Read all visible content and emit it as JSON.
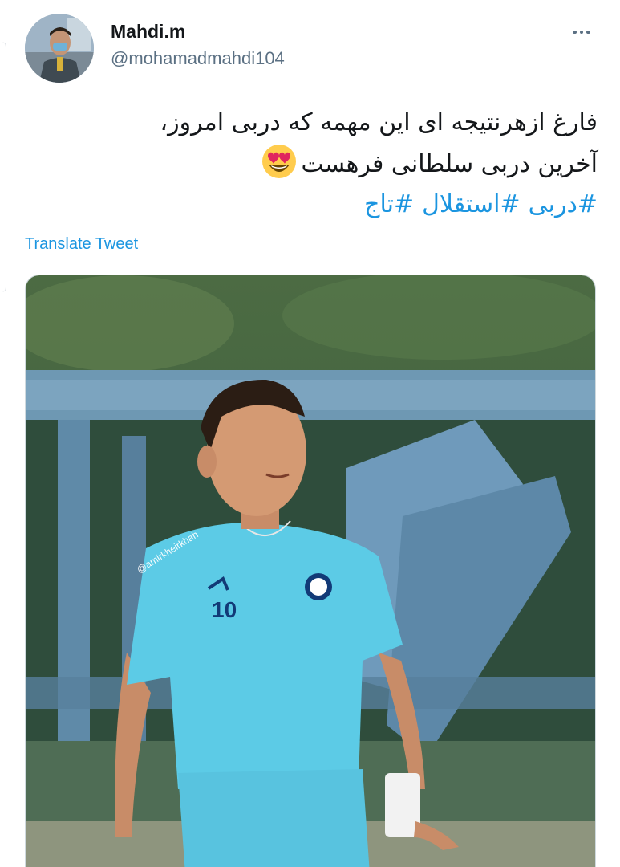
{
  "tweet": {
    "author": {
      "display_name": "Mahdi.m",
      "handle": "@mohamadmahdi104"
    },
    "text": {
      "line1": "فارغ ازهرنتیجه ای این مهمه که دربی امروز،",
      "line2": "آخرین دربی سلطانی فرهست",
      "emoji": "smiling-face-with-heart-eyes",
      "hashtags": [
        "#دربی",
        "#استقلال",
        "#تاج"
      ]
    },
    "translate_label": "Translate Tweet",
    "media": {
      "watermark": "@amirkheirkhah",
      "jersey_number": "10"
    }
  },
  "icons": {
    "more": "more-horizontal-icon"
  },
  "colors": {
    "link": "#1b95e0",
    "secondary_text": "#5b7083",
    "jersey": "#5ccbe6"
  }
}
